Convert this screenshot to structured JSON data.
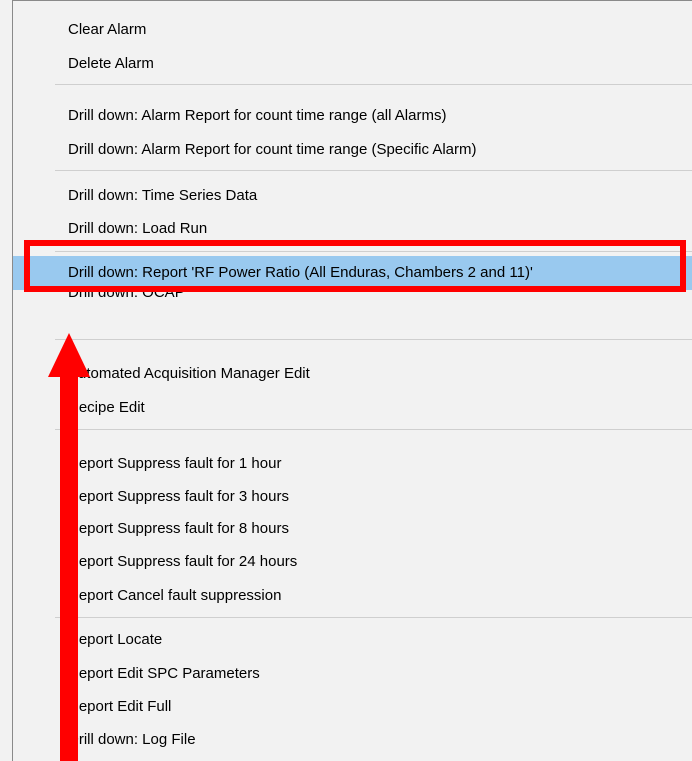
{
  "menu": {
    "items": [
      {
        "label": "Clear Alarm"
      },
      {
        "label": "Delete Alarm"
      },
      {
        "label": "Drill down: Alarm Report for count time range (all Alarms)"
      },
      {
        "label": "Drill down: Alarm Report for count time range (Specific Alarm)"
      },
      {
        "label": "Drill down: Time Series Data"
      },
      {
        "label": "Drill down: Load Run"
      },
      {
        "label": "Drill down: Report 'RF Power Ratio (All Enduras, Chambers 2 and 11)'",
        "state": "highlighted"
      },
      {
        "label": "Drill down: OCAP"
      },
      {
        "label": "Automated Acquisition Manager Edit"
      },
      {
        "label": "Recipe Edit"
      },
      {
        "label": "Report Suppress fault for 1 hour"
      },
      {
        "label": "Report Suppress fault for 3 hours"
      },
      {
        "label": "Report Suppress fault for 8 hours"
      },
      {
        "label": "Report Suppress fault for 24 hours"
      },
      {
        "label": "Report Cancel fault suppression"
      },
      {
        "label": "Report Locate"
      },
      {
        "label": "Report Edit SPC Parameters"
      },
      {
        "label": "Report Edit Full"
      },
      {
        "label": "Drill down: Log File"
      }
    ]
  },
  "annotation": {
    "highlight_color": "#ff0000",
    "selected_item_color": "#99c9ef"
  }
}
